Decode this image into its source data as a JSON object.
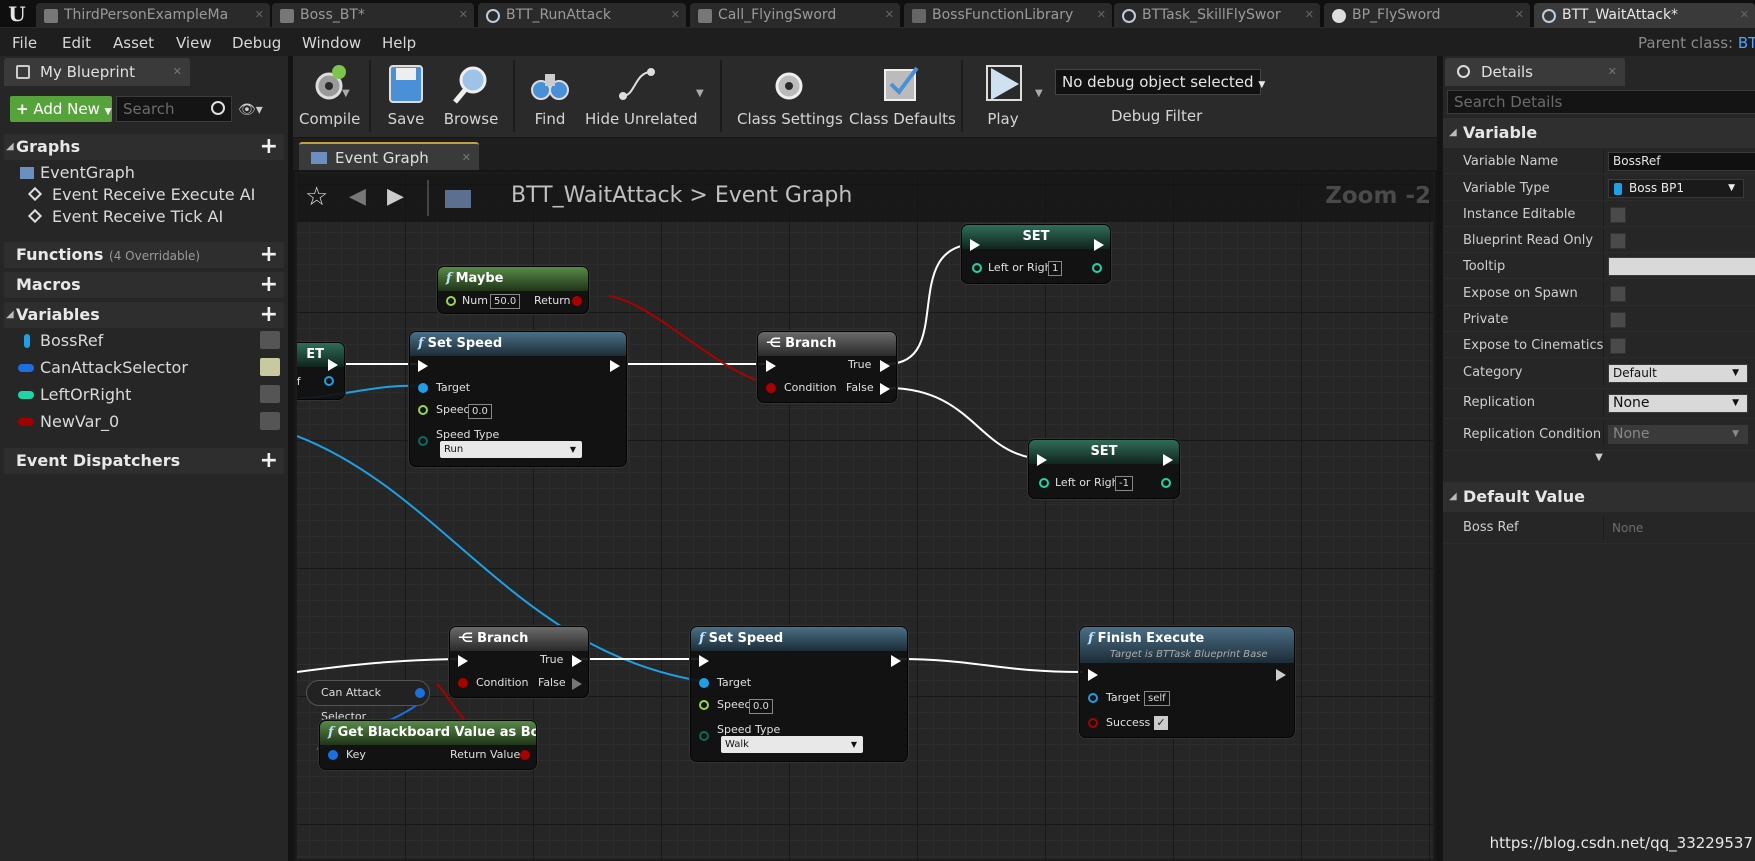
{
  "tabs": [
    {
      "label": "ThirdPersonExampleMa",
      "icon": "level-icon",
      "active": false
    },
    {
      "label": "Boss_BT*",
      "icon": "behavior-tree-icon",
      "active": false
    },
    {
      "label": "BTT_RunAttack",
      "icon": "task-icon",
      "active": false
    },
    {
      "label": "Call_FlyingSword",
      "icon": "level-icon",
      "active": false
    },
    {
      "label": "BossFunctionLibrary",
      "icon": "function-library-icon",
      "active": false
    },
    {
      "label": "BTTask_SkillFlySwor",
      "icon": "task-icon",
      "active": false
    },
    {
      "label": "BP_FlySword",
      "icon": "sphere-icon",
      "active": false
    },
    {
      "label": "BTT_WaitAttack*",
      "icon": "task-icon",
      "active": true
    }
  ],
  "menu": [
    "File",
    "Edit",
    "Asset",
    "View",
    "Debug",
    "Window",
    "Help"
  ],
  "parent_class": {
    "label": "Parent class:",
    "value": "BT"
  },
  "my_blueprint": {
    "tab_label": "My Blueprint",
    "add_new": "Add New",
    "search_placeholder": "Search",
    "sections": {
      "graphs": "Graphs",
      "functions": "Functions",
      "functions_sub": "(4 Overridable)",
      "macros": "Macros",
      "variables": "Variables",
      "dispatchers": "Event Dispatchers"
    },
    "graph_items": [
      "EventGraph",
      "Event Receive Execute AI",
      "Event Receive Tick AI"
    ],
    "variables": [
      {
        "name": "BossRef",
        "color": "#1ea0e6"
      },
      {
        "name": "CanAttackSelector",
        "color": "#1c6fe0"
      },
      {
        "name": "LeftOrRight",
        "color": "#1dd6a8"
      },
      {
        "name": "NewVar_0",
        "color": "#a00000"
      }
    ]
  },
  "toolbar": {
    "compile": "Compile",
    "save": "Save",
    "browse": "Browse",
    "find": "Find",
    "hide_unrelated": "Hide Unrelated",
    "class_settings": "Class Settings",
    "class_defaults": "Class Defaults",
    "play": "Play",
    "debug_select": "No debug object selected",
    "debug_filter": "Debug Filter"
  },
  "graph": {
    "tab_label": "Event Graph",
    "breadcrumb_root": "BTT_WaitAttack",
    "breadcrumb_sep": ">",
    "breadcrumb_leaf": "Event Graph",
    "zoom": "Zoom -2",
    "nodes": {
      "maybe": {
        "title": "Maybe",
        "num_label": "Num",
        "num_value": "50.0",
        "return_label": "Return"
      },
      "set_speed_1": {
        "title": "Set Speed",
        "target": "Target",
        "speed": "Speed",
        "speed_value": "0.0",
        "speed_type": "Speed Type",
        "speed_type_value": "Run"
      },
      "branch_1": {
        "title": "Branch",
        "condition": "Condition",
        "true_label": "True",
        "false_label": "False"
      },
      "set_1": {
        "title": "SET",
        "var": "Left or Right",
        "value": "1"
      },
      "set_2": {
        "title": "SET",
        "var": "Left or Right",
        "value": "-1"
      },
      "partial": {
        "title": "ET",
        "pin": "ef"
      },
      "branch_2": {
        "title": "Branch",
        "condition": "Condition",
        "true_label": "True",
        "false_label": "False"
      },
      "set_speed_2": {
        "title": "Set Speed",
        "target": "Target",
        "speed": "Speed",
        "speed_value": "0.0",
        "speed_type": "Speed Type",
        "speed_type_value": "Walk"
      },
      "finish": {
        "title": "Finish Execute",
        "subtitle": "Target is BTTask Blueprint Base",
        "target": "Target",
        "target_value": "self",
        "success": "Success"
      },
      "can_attack": {
        "title": "Can Attack Selector"
      },
      "get_bb": {
        "title": "Get Blackboard Value as Bool",
        "key": "Key",
        "ret": "Return Value"
      }
    }
  },
  "details": {
    "tab_label": "Details",
    "search_placeholder": "Search Details",
    "variable_section": "Variable",
    "default_section": "Default Value",
    "rows": {
      "variable_name": {
        "label": "Variable Name",
        "value": "BossRef"
      },
      "variable_type": {
        "label": "Variable Type",
        "value": "Boss BP1"
      },
      "instance_editable": {
        "label": "Instance Editable"
      },
      "blueprint_read_only": {
        "label": "Blueprint Read Only"
      },
      "tooltip": {
        "label": "Tooltip",
        "value": ""
      },
      "expose_on_spawn": {
        "label": "Expose on Spawn"
      },
      "private": {
        "label": "Private"
      },
      "expose_cinematics": {
        "label": "Expose to Cinematics"
      },
      "category": {
        "label": "Category",
        "value": "Default"
      },
      "replication": {
        "label": "Replication",
        "value": "None"
      },
      "replication_condition": {
        "label": "Replication Condition",
        "value": "None"
      },
      "boss_ref": {
        "label": "Boss Ref",
        "value": "None"
      }
    }
  },
  "watermark": "https://blog.csdn.net/qq_33229537"
}
